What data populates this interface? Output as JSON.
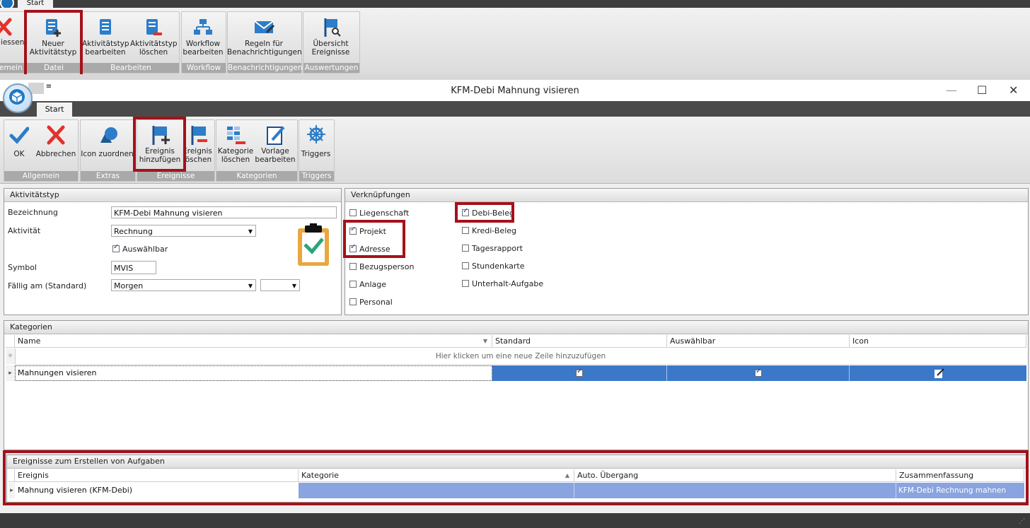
{
  "back_window": {
    "tab": "Start",
    "buttons": {
      "close_partial": "liessen",
      "new_type_1": "Neuer",
      "new_type_2": "Aktivitätstyp",
      "edit_type_1": "Aktivitätstyp",
      "edit_type_2": "bearbeiten",
      "del_type_1": "Aktivitätstyp",
      "del_type_2": "löschen",
      "workflow_1": "Workflow",
      "workflow_2": "bearbeiten",
      "rules_1": "Regeln für",
      "rules_2": "Benachrichtigungen",
      "overview_1": "Übersicht",
      "overview_2": "Ereignisse"
    },
    "groups": {
      "allgemein_partial": "emein",
      "datei": "Datei",
      "bearbeiten": "Bearbeiten",
      "workflow": "Workflow",
      "benachrichtigungen": "Benachrichtigungen",
      "auswertungen": "Auswertungen"
    }
  },
  "dialog": {
    "title": "KFM-Debi Mahnung visieren",
    "qat": "≡",
    "minimize": "—",
    "maximize": "☐",
    "close": "✕",
    "tab": "Start",
    "buttons": {
      "ok": "OK",
      "abbrechen": "Abbrechen",
      "icon_zuordnen": "Icon zuordnen",
      "ereignis_hinzu_1": "Ereignis",
      "ereignis_hinzu_2": "hinzufügen",
      "ereignis_loeschen_1": "Ereignis",
      "ereignis_loeschen_2": "löschen",
      "kategorie_loeschen_1": "Kategorie",
      "kategorie_loeschen_2": "löschen",
      "vorlage_1": "Vorlage",
      "vorlage_2": "bearbeiten",
      "triggers": "Triggers"
    },
    "groups": {
      "allgemein": "Allgemein",
      "extras": "Extras",
      "ereignisse": "Ereignisse",
      "kategorien": "Kategorien",
      "triggers": "Triggers"
    }
  },
  "activity_type": {
    "header": "Aktivitätstyp",
    "bezeichnung_label": "Bezeichnung",
    "bezeichnung_value": "KFM-Debi Mahnung visieren",
    "aktivitaet_label": "Aktivität",
    "aktivitaet_value": "Rechnung",
    "auswaehlbar_label": "Auswählbar",
    "auswaehlbar_checked": true,
    "symbol_label": "Symbol",
    "symbol_value": "MVIS",
    "faellig_label": "Fällig am (Standard)",
    "faellig_value": "Morgen",
    "faellig_extra_value": ""
  },
  "links": {
    "header": "Verknüpfungen",
    "col1": [
      {
        "label": "Liegenschaft",
        "checked": false
      },
      {
        "label": "Projekt",
        "checked": true
      },
      {
        "label": "Adresse",
        "checked": true
      },
      {
        "label": "Bezugsperson",
        "checked": false
      },
      {
        "label": "Anlage",
        "checked": false
      },
      {
        "label": "Personal",
        "checked": false
      }
    ],
    "col2": [
      {
        "label": "Debi-Beleg",
        "checked": true
      },
      {
        "label": "Kredi-Beleg",
        "checked": false
      },
      {
        "label": "Tagesrapport",
        "checked": false
      },
      {
        "label": "Stundenkarte",
        "checked": false
      },
      {
        "label": "Unterhalt-Aufgabe",
        "checked": false
      }
    ]
  },
  "categories": {
    "header": "Kategorien",
    "columns": [
      "Name",
      "Standard",
      "Auswählbar",
      "Icon"
    ],
    "new_row_hint": "Hier klicken um eine neue Zeile hinzuzufügen",
    "rows": [
      {
        "name": "Mahnungen visieren",
        "standard": true,
        "auswaehlbar": true
      }
    ]
  },
  "events": {
    "header": "Ereignisse zum Erstellen von Aufgaben",
    "columns": [
      "Ereignis",
      "Kategorie",
      "Auto. Übergang",
      "Zusammenfassung"
    ],
    "rows": [
      {
        "ereignis": "Mahnung visieren (KFM-Debi)",
        "kategorie": "",
        "auto": "",
        "zusammenfassung": "KFM-Debi Rechnung mahnen"
      }
    ]
  },
  "colors": {
    "highlight": "#a5111a",
    "selection": "#3b78c8",
    "selection_light": "#8aa4e0",
    "ribbon_group_label": "#a9a9a9"
  }
}
